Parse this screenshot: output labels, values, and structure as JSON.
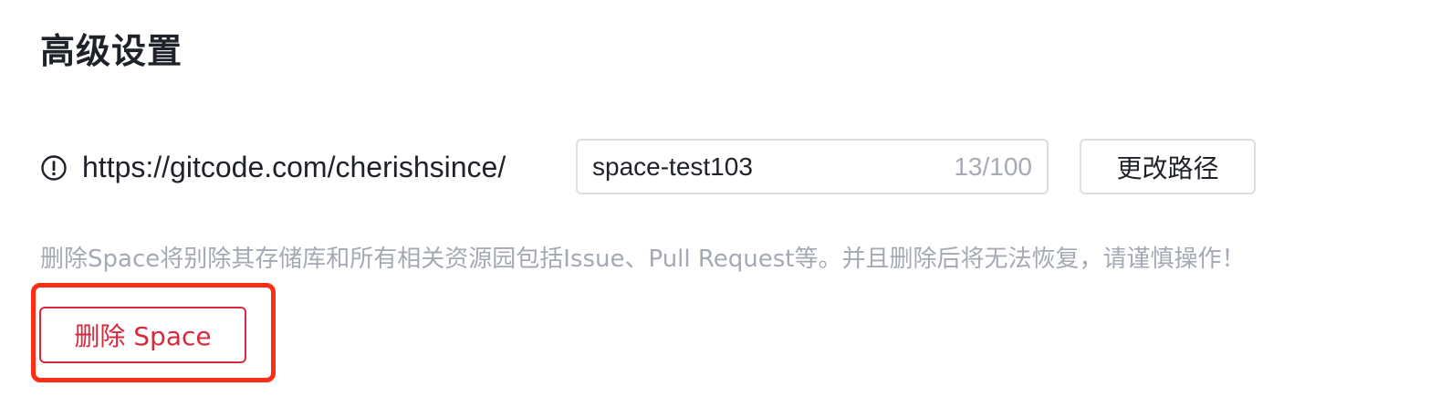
{
  "section": {
    "title": "高级设置"
  },
  "path": {
    "icon": "info-icon",
    "url_prefix": "https://gitcode.com/cherishsince/",
    "input_value": "space-test103",
    "char_count": "13/100",
    "change_button_label": "更改路径"
  },
  "danger": {
    "warning_text": "删除Space将别除其存储库和所有相关资源园包括Issue、Pull Request等。并且删除后将无法恢复，请谨慎操作！",
    "delete_button_label": "删除 Space"
  },
  "colors": {
    "danger": "#d9293d",
    "highlight": "#ff2d16",
    "muted": "#a4a9b3",
    "text": "#1f2329"
  }
}
